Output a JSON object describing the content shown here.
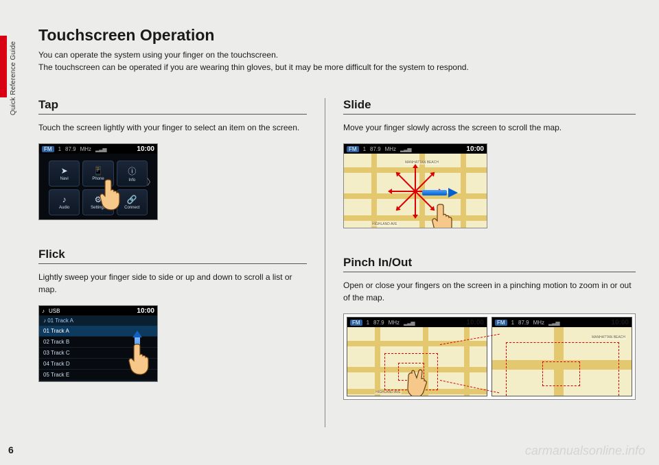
{
  "side_label": "Quick Reference Guide",
  "page_number": "6",
  "watermark": "carmanualsonline.info",
  "title": "Touchscreen Operation",
  "intro_line1": "You can operate the system using your finger on the touchscreen.",
  "intro_line2": "The touchscreen can be operated if you are wearing thin gloves, but it may be more difficult for the system to respond.",
  "sections": {
    "tap": {
      "heading": "Tap",
      "desc": "Touch the screen lightly with your finger to select an item on the screen.",
      "tiles": [
        "Navi",
        "Phone",
        "Info",
        "Audio",
        "Settings",
        "Connect"
      ],
      "tile_icons": [
        "➤",
        "📱",
        "ⓘ",
        "♪",
        "⚙",
        "🔗"
      ],
      "status": {
        "fm": "FM",
        "ch": "1",
        "freq": "87.9",
        "unit": "MHz",
        "clock": "10:00"
      }
    },
    "flick": {
      "heading": "Flick",
      "desc": "Lightly sweep your finger side to side or up and down to scroll a list or map.",
      "header_src": "USB",
      "nowplaying": "♪ 01 Track A",
      "rows": [
        "01  Track A",
        "02  Track B",
        "03  Track C",
        "04  Track D",
        "05  Track E"
      ],
      "clock": "10:00"
    },
    "slide": {
      "heading": "Slide",
      "desc": "Move your finger slowly across the screen to scroll the map.",
      "status": {
        "fm": "FM",
        "ch": "1",
        "freq": "87.9",
        "unit": "MHz",
        "clock": "10:00"
      },
      "labels": [
        "MANHATTAN BEACH",
        "HIGHLAND AVE"
      ]
    },
    "pinch": {
      "heading": "Pinch In/Out",
      "desc": "Open or close your fingers on the screen in a pinching motion to zoom in or out of the map.",
      "status": {
        "fm": "FM",
        "ch": "1",
        "freq": "87.9",
        "unit": "MHz",
        "clock": "10:00"
      },
      "labels": [
        "MANHATTAN BEACH",
        "HIGHLAND AVE"
      ]
    }
  }
}
